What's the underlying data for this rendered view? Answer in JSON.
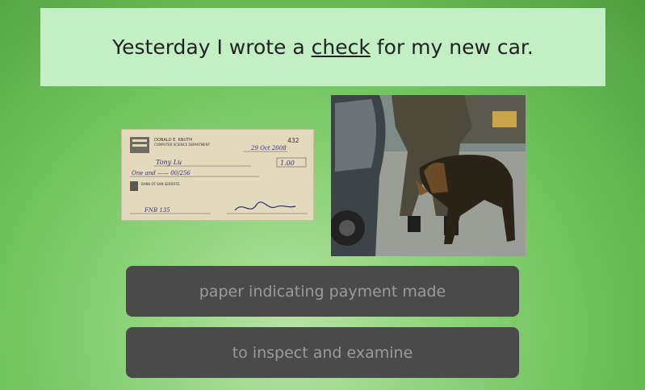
{
  "sentence": {
    "before": "Yesterday I wrote a ",
    "word": "check",
    "after": " for my new car."
  },
  "check_image": {
    "name": "DONALD E. KNUTH",
    "dept": "COMPUTER SCIENCE DEPARTMENT",
    "number": "432",
    "date": "29 Oct 2008",
    "payee": "Tony Lu",
    "amount": "1.00",
    "amount_words": "One and —— 00/256",
    "bank": "BANK OF SAN SERRIFFE",
    "memo": "FNB 135"
  },
  "choices": [
    {
      "label": "paper indicating payment made"
    },
    {
      "label": "to inspect and examine"
    }
  ]
}
